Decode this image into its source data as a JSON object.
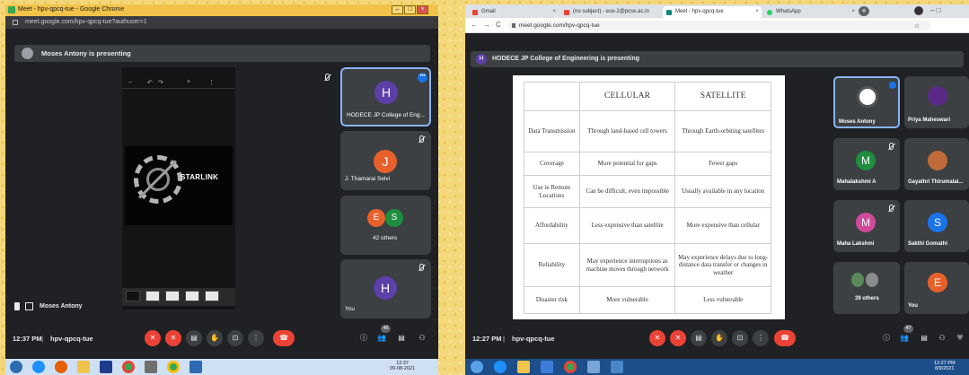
{
  "left": {
    "window_title": "Meet - hpv-qpcq-tue - Google Chrome",
    "url": "meet.google.com/hpv-qpcq-tue?authuser=1",
    "presenting_banner": "Moses Antony is presenting",
    "slide": {
      "title": "STARLINK"
    },
    "participants": [
      {
        "initial": "H",
        "name": "HODECE JP College of Eng...",
        "color": "#5c3fa8"
      },
      {
        "initial": "J",
        "name": "J. Thamarai Selvi",
        "color": "#e8612c"
      },
      {
        "initials": [
          "E",
          "S"
        ],
        "colors": [
          "#e8612c",
          "#1e8e3e"
        ],
        "name": "42 others"
      },
      {
        "initial": "H",
        "name": "You",
        "color": "#5c3fa8"
      }
    ],
    "self_label": "Moses Antony",
    "meeting_time": "12:37 PM",
    "meeting_code": "hpv-qpcq-tue",
    "people_count": "46",
    "clock_time": "12:37",
    "clock_date": "09-08-2021"
  },
  "right": {
    "tabs": [
      {
        "label": "Gmail",
        "color": "#ea4335"
      },
      {
        "label": "(no subject) - ece-2@pcse.ac.in",
        "color": "#ea4335"
      },
      {
        "label": "Meet - hpv-qpcq-tue",
        "color": "#00897b"
      },
      {
        "label": "WhatsApp",
        "color": "#25d366"
      }
    ],
    "url": "meet.google.com/hpv-qpcq-tue",
    "presenting_banner": "HODECE JP College of Engineering is presenting",
    "table": {
      "headers": [
        "",
        "CELLULAR",
        "SATELLITE"
      ],
      "rows": [
        [
          "Data Transmission",
          "Through land-based cell towers",
          "Through Earth-orbiting satellites"
        ],
        [
          "Coverage",
          "More potential for gaps",
          "Fewer gaps"
        ],
        [
          "Use in Remote Locations",
          "Can be difficult, even impossible",
          "Usually available in any location"
        ],
        [
          "Affordability",
          "Less expensive than satellite",
          "More expensive than cellular"
        ],
        [
          "Reliability",
          "May experience interruptions as machine moves through network",
          "May experience delays due to long-distance data transfer or changes in weather"
        ],
        [
          "Disaster risk",
          "More vulnerable",
          "Less vulnerable"
        ]
      ]
    },
    "participants": [
      {
        "name": "Moses Antony",
        "color": "#ffffff"
      },
      {
        "name": "Priya Maheswari",
        "color": "#5b2a86"
      },
      {
        "initial": "M",
        "name": "Mahalakshmi A",
        "color": "#1e8e3e"
      },
      {
        "name": "Gayathri Thirumalai...",
        "color": "#c06b3a"
      },
      {
        "initial": "M",
        "name": "Maha Lakshmi",
        "color": "#d0499a"
      },
      {
        "initial": "S",
        "name": "Sakthi Gomathi",
        "color": "#1a73e8"
      },
      {
        "name": "39 others",
        "color": "#5a8a5a"
      },
      {
        "initial": "E",
        "name": "You",
        "color": "#e8612c"
      }
    ],
    "meeting_time": "12:27 PM",
    "meeting_code": "hpv-qpcq-tue",
    "people_count": "47",
    "clock_time": "12:27 PM",
    "clock_date": "8/9/2021"
  }
}
